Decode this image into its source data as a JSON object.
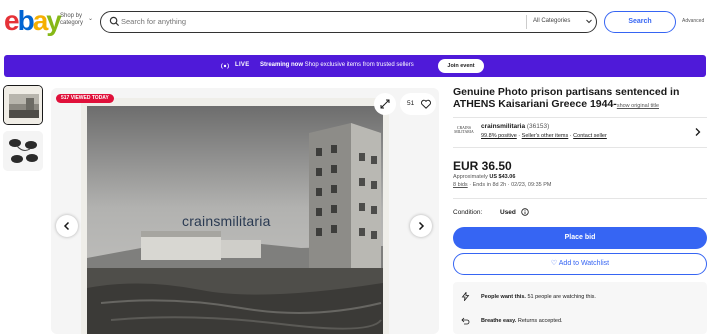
{
  "header": {
    "logo": {
      "e": "e",
      "b": "b",
      "a": "a",
      "y": "y"
    },
    "shop_by_line1": "Shop by",
    "shop_by_line2": "category",
    "search_placeholder": "Search for anything",
    "category_select": "All Categories",
    "search_button": "Search",
    "advanced_link": "Advanced"
  },
  "banner": {
    "live_label": "LIVE",
    "streaming_bold": "Streaming now",
    "streaming_text": " Shop exclusive items from trusted sellers",
    "join_button": "Join event",
    "background": "#4f1ad9"
  },
  "gallery": {
    "badge": "517 VIEWED TODAY",
    "watch_count": "51",
    "watermark": "crainsmilitaria"
  },
  "listing": {
    "title": "Genuine Photo prison partisans sentenced in ATHENS Kaisariani Greece 1944-",
    "show_original": "show original title",
    "seller": {
      "logo_line1": "CRAINS",
      "logo_line2": "MILITARIA",
      "name": "crainsmilitaria",
      "feedback_count": " (36153)",
      "positive": "99.8% positive",
      "dot1": " · ",
      "other_items": "Seller's other items",
      "dot2": " · ",
      "contact": "Contact seller"
    },
    "price": "EUR 36.50",
    "approx_prefix": "Approximately ",
    "approx_value": "US $43.06",
    "bids": "8 bids",
    "ends": " · Ends in 8d 2h · 02/23, 09:35 PM",
    "condition_label": "Condition:",
    "condition_value": "Used",
    "place_bid": "Place bid",
    "add_watchlist": "♡ Add to Watchlist",
    "info": {
      "want_bold": "People want this.",
      "want_text": " 51 people are watching this.",
      "breathe_bold": "Breathe easy.",
      "breathe_text": " Returns accepted."
    }
  },
  "colors": {
    "accent": "#3665f3",
    "badge": "#e0103a"
  }
}
